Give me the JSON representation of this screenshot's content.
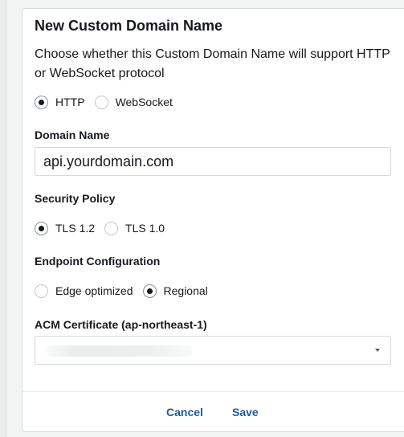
{
  "dialog": {
    "title": "New Custom Domain Name",
    "description": "Choose whether this Custom Domain Name will support HTTP or WebSocket protocol"
  },
  "protocol": {
    "options": [
      {
        "label": "HTTP",
        "selected": true
      },
      {
        "label": "WebSocket",
        "selected": false
      }
    ]
  },
  "domain_name": {
    "label": "Domain Name",
    "value": "api.yourdomain.com"
  },
  "security_policy": {
    "label": "Security Policy",
    "options": [
      {
        "label": "TLS 1.2",
        "selected": true
      },
      {
        "label": "TLS 1.0",
        "selected": false
      }
    ]
  },
  "endpoint_configuration": {
    "label": "Endpoint Configuration",
    "options": [
      {
        "label": "Edge optimized",
        "selected": false
      },
      {
        "label": "Regional",
        "selected": true
      }
    ]
  },
  "acm_certificate": {
    "label": "ACM Certificate (ap-northeast-1)",
    "value_redacted": true
  },
  "footer": {
    "cancel_label": "Cancel",
    "save_label": "Save"
  },
  "colors": {
    "link": "#1a5b9e",
    "border": "#d5dbdb",
    "text": "#16191f"
  }
}
